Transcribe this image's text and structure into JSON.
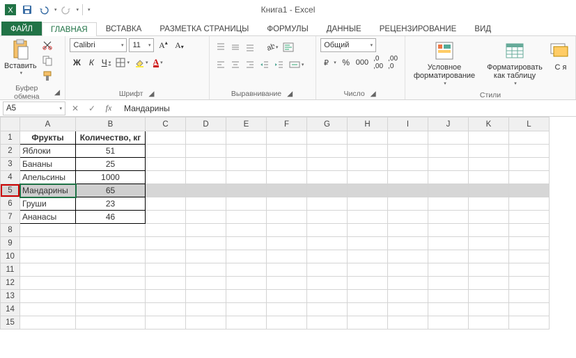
{
  "app_title": "Книга1 - Excel",
  "tabs": [
    "ФАЙЛ",
    "ГЛАВНАЯ",
    "ВСТАВКА",
    "РАЗМЕТКА СТРАНИЦЫ",
    "ФОРМУЛЫ",
    "ДАННЫЕ",
    "РЕЦЕНЗИРОВАНИЕ",
    "ВИД"
  ],
  "active_tab": 1,
  "ribbon": {
    "clipboard": {
      "paste": "Вставить",
      "label": "Буфер обмена"
    },
    "font": {
      "name": "Calibri",
      "size": "11",
      "bold": "Ж",
      "italic": "К",
      "underline": "Ч",
      "label": "Шрифт"
    },
    "align": {
      "label": "Выравнивание"
    },
    "number": {
      "format": "Общий",
      "label": "Число"
    },
    "styles": {
      "cond": "Условное форматирование",
      "table": "Форматировать как таблицу",
      "cell": "С я",
      "label": "Стили"
    }
  },
  "namebox": "A5",
  "formula": "Мандарины",
  "columns": [
    "A",
    "B",
    "C",
    "D",
    "E",
    "F",
    "G",
    "H",
    "I",
    "J",
    "K",
    "L"
  ],
  "rows": [
    {
      "n": 1,
      "a": "Фрукты",
      "b": "Количество, кг",
      "header": true
    },
    {
      "n": 2,
      "a": "Яблоки",
      "b": "51"
    },
    {
      "n": 3,
      "a": "Бананы",
      "b": "25"
    },
    {
      "n": 4,
      "a": "Апельсины",
      "b": "1000"
    },
    {
      "n": 5,
      "a": "Мандарины",
      "b": "65",
      "selected": true
    },
    {
      "n": 6,
      "a": "Груши",
      "b": "23"
    },
    {
      "n": 7,
      "a": "Ананасы",
      "b": "46"
    },
    {
      "n": 8
    },
    {
      "n": 9
    },
    {
      "n": 10
    },
    {
      "n": 11
    },
    {
      "n": 12
    },
    {
      "n": 13
    },
    {
      "n": 14
    },
    {
      "n": 15
    }
  ],
  "chart_data": {
    "type": "table",
    "title": "Фрукты — Количество, кг",
    "columns": [
      "Фрукты",
      "Количество, кг"
    ],
    "rows": [
      [
        "Яблоки",
        51
      ],
      [
        "Бананы",
        25
      ],
      [
        "Апельсины",
        1000
      ],
      [
        "Мандарины",
        65
      ],
      [
        "Груши",
        23
      ],
      [
        "Ананасы",
        46
      ]
    ]
  }
}
